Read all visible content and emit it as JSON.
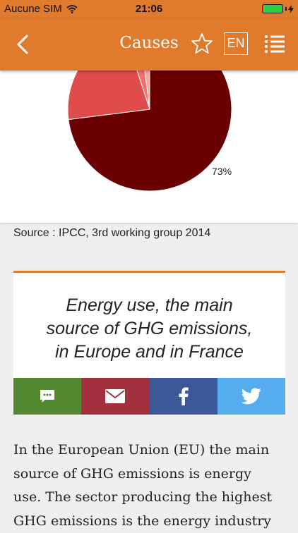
{
  "status_bar": {
    "carrier": "Aucune SIM",
    "time": "21:06",
    "battery_level": 1.0
  },
  "nav": {
    "title": "Causes",
    "language": "EN",
    "icons": [
      "back-chevron-icon",
      "star-icon",
      "list-menu-icon"
    ]
  },
  "chart_data": {
    "type": "pie",
    "slices": [
      {
        "label": "73%",
        "value": 73,
        "color": "#6b0000"
      },
      {
        "value": 22,
        "color": "#e04b4b"
      },
      {
        "value": 3,
        "color": "#f27070"
      },
      {
        "value": 2,
        "color": "#f7a5a5"
      }
    ]
  },
  "source": "Source : IPCC, 3rd working group 2014",
  "article": {
    "title_lines": [
      "Energy use, the main",
      "source of GHG emissions,",
      "in Europe and in France"
    ]
  },
  "share": {
    "buttons": [
      "sms-icon",
      "mail-icon",
      "facebook-icon",
      "twitter-icon"
    ],
    "colors": {
      "sms": "#52882f",
      "mail": "#a2313d",
      "facebook": "#3b5998",
      "twitter": "#55acee"
    }
  },
  "body_lines": [
    "In the European Union (EU) the main",
    "source of GHG emissions is energy",
    "use. The sector producing the highest",
    "GHG emissions is the energy industry"
  ],
  "colors": {
    "brand": "#e07a2c"
  }
}
